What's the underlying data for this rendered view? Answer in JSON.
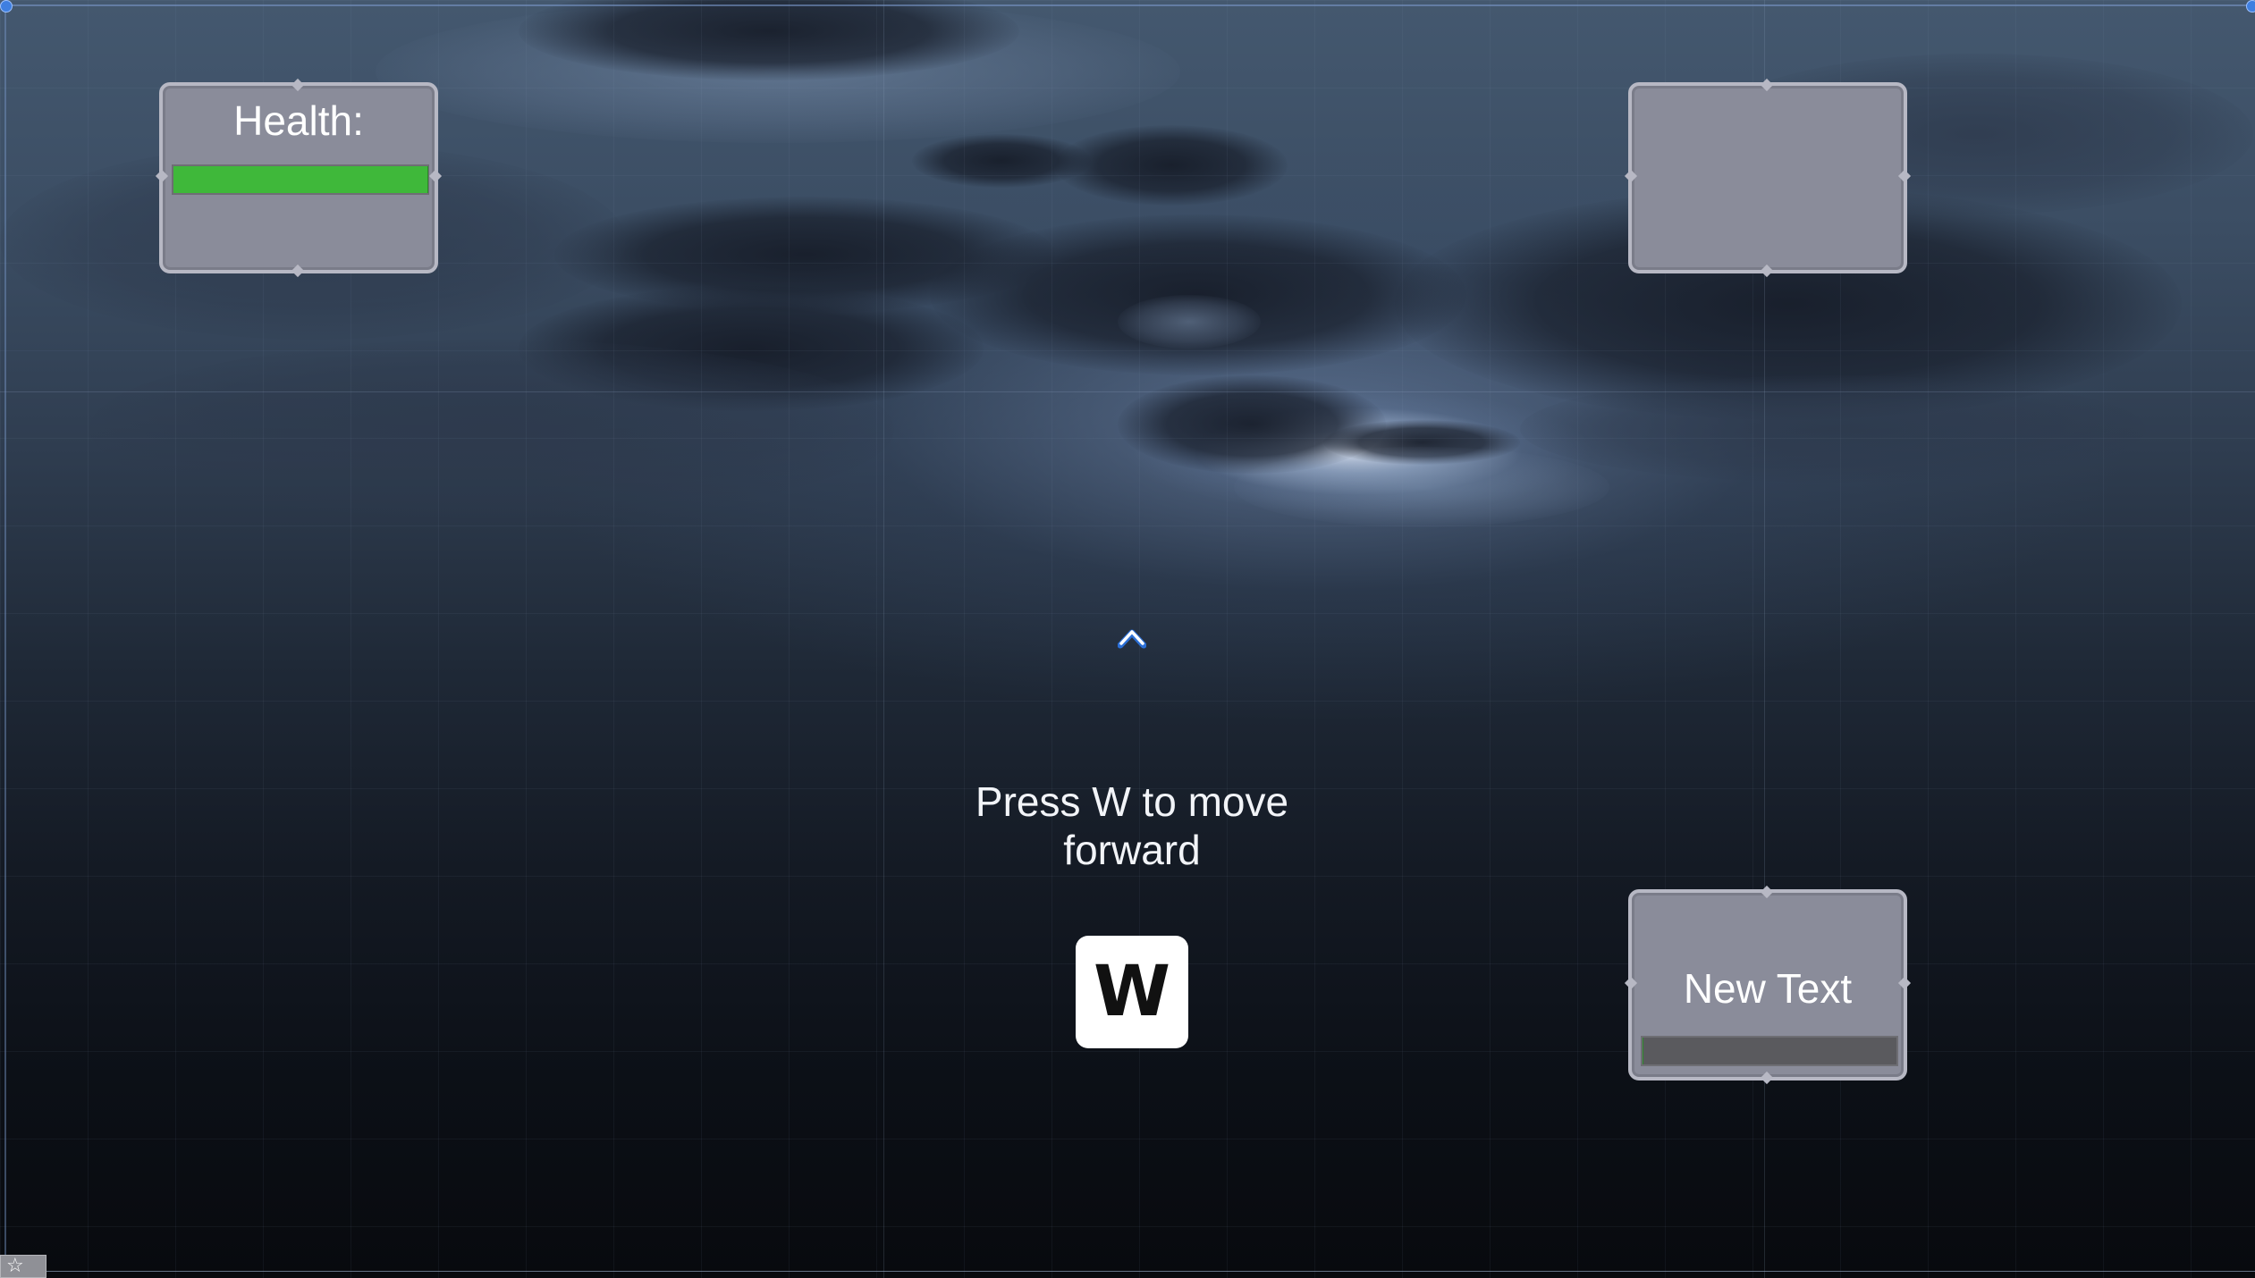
{
  "health_panel": {
    "label": "Health:",
    "health_fraction": 1.0,
    "bar_color": "#3fb83a"
  },
  "top_right_panel": {
    "label": ""
  },
  "bottom_right_panel": {
    "label": "New Text",
    "bar_fraction": 0.0,
    "bar_color": "#5a5a5e"
  },
  "tutorial": {
    "prompt": "Press W to move forward",
    "key_label": "W"
  },
  "crosshair_icon": "chevron-up-icon",
  "editor_toolbar": {
    "icon": "star-icon",
    "glyph": "☆"
  },
  "colors": {
    "panel_fill": "#8a8c9a",
    "panel_border": "#b7b8c4",
    "text": "#ffffff"
  }
}
